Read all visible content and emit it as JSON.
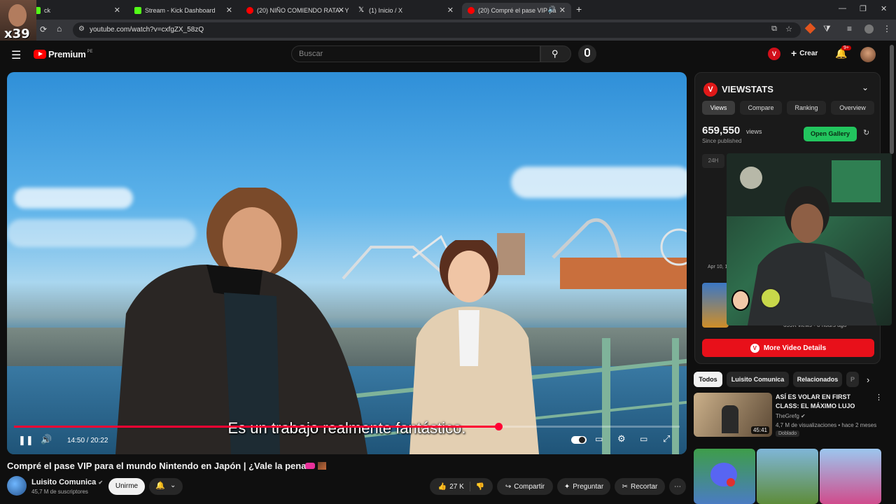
{
  "browser": {
    "tabs": [
      {
        "title": "ck",
        "favicon_color": "#53fc18"
      },
      {
        "title": "Stream - Kick Dashboard",
        "favicon_color": "#53fc18"
      },
      {
        "title": "(20) NIÑO COMIENDO RATA - Y",
        "favicon_color": "#ff0000"
      },
      {
        "title": "(1) Inicio / X",
        "favicon_color": "#ffffff"
      },
      {
        "title": "(20) Compré el pase VIP pa",
        "favicon_color": "#ff0000"
      }
    ],
    "url": "youtube.com/watch?v=cxfgZX_58zQ",
    "new_tab_label": "+"
  },
  "overlay": {
    "cam_label": "x39"
  },
  "youtube": {
    "logo_text": "Premium",
    "logo_region": "PE",
    "search_placeholder": "Buscar",
    "create_label": "Crear",
    "notif_count": "9+",
    "ext_badge": "V"
  },
  "player": {
    "caption": "Es un trabajo realmente fantástico.",
    "time": "14:50 / 20:22",
    "progress": 0.728
  },
  "video": {
    "title": "Compré el pase VIP para el mundo Nintendo en Japón | ¿Vale la pena?",
    "channel": "Luisito Comunica",
    "subscribers": "45,7 M de suscriptores",
    "join_label": "Unirme",
    "likes": "27 K",
    "share_label": "Compartir",
    "ask_label": "Preguntar",
    "clip_label": "Recortar"
  },
  "viewstats": {
    "title": "VIEWSTATS",
    "logo_letter": "V",
    "tabs": [
      "Views",
      "Compare",
      "Ranking",
      "Overview"
    ],
    "views": "659,550",
    "views_unit": "views",
    "since": "Since published",
    "gallery_label": "Open Gallery",
    "range_label": "24H",
    "chart_date": "Apr 10, 1",
    "video_meta": "659K views • 8 hours ago",
    "more_label": "More Video Details"
  },
  "chips": [
    "Todos",
    "Luisito Comunica",
    "Relacionados",
    "P"
  ],
  "recommended": [
    {
      "title": "ASÍ ES VOLAR EN FIRST CLASS: EL MÁXIMO LUJO",
      "channel": "TheGrefg",
      "stats": "4,7 M de visualizaciones • hace 2 meses",
      "badge": "Doblado",
      "duration": "45:41"
    }
  ],
  "colors": {
    "accent": "#ff0033",
    "viewstats_red": "#e8101a",
    "gallery_green": "#22c55e"
  }
}
